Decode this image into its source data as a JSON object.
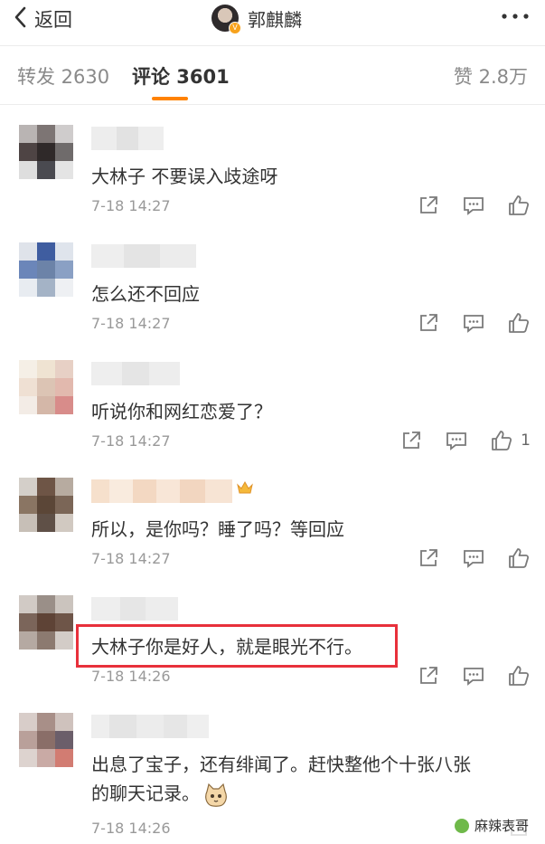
{
  "header": {
    "back_label": "返回",
    "author_name": "郭麒麟",
    "badge": "V"
  },
  "tabs": {
    "repost": "转发 2630",
    "comment": "评论 3601",
    "like": "赞 2.8万"
  },
  "comments": [
    {
      "text": "大林子 不要误入歧途呀",
      "time": "7-18 14:27",
      "likes": ""
    },
    {
      "text": "怎么还不回应",
      "time": "7-18 14:27",
      "likes": ""
    },
    {
      "text": "听说你和网红恋爱了？",
      "time": "7-18 14:27",
      "likes": "1"
    },
    {
      "text": "所以，是你吗？睡了吗？等回应",
      "time": "7-18 14:27",
      "likes": ""
    },
    {
      "text": "大林子你是好人，就是眼光不行。",
      "time": "7-18 14:26",
      "likes": ""
    },
    {
      "text_line1": "出息了宝子，还有绯闻了。赶快整他个十张八张",
      "text_line2": "的聊天记录。",
      "time": "7-18 14:26",
      "likes": ""
    }
  ],
  "watermark": "麻辣表哥",
  "colors": {
    "accent": "#ff8200",
    "highlight_border": "#e8303b",
    "text": "#333333",
    "muted": "#999999"
  }
}
